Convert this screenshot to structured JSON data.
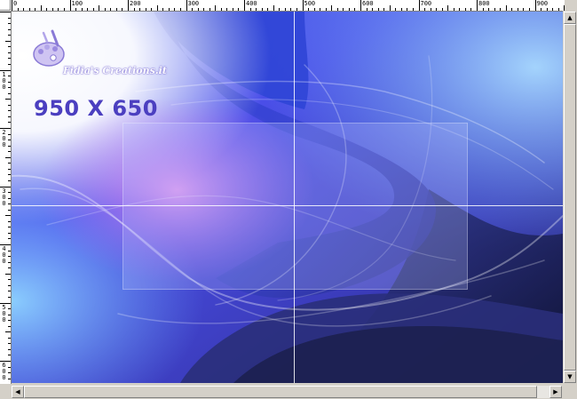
{
  "ruler": {
    "top_labels": [
      "0",
      "100",
      "200",
      "300",
      "400",
      "500",
      "600",
      "700",
      "800",
      "900"
    ],
    "left_labels": [
      "1\n0\n0",
      "2\n0\n0",
      "3\n0\n0",
      "4\n0\n0",
      "5\n0\n0",
      "6\n0\n0"
    ]
  },
  "canvas": {
    "size_label": "950 X 650",
    "logo_text": "Fidia's Creations.it",
    "colors": {
      "deep_blue": "#2c2fc6",
      "violet": "#6a4cf0",
      "sky": "#7fc3ff",
      "pink": "#d98ef0",
      "navy": "#151a4a",
      "label": "#4b3fc0"
    }
  },
  "icons": {
    "logo": "palette-logo-icon",
    "scroll_up": "arrow-up-icon",
    "scroll_down": "arrow-down-icon",
    "scroll_left": "arrow-left-icon",
    "scroll_right": "arrow-right-icon"
  }
}
